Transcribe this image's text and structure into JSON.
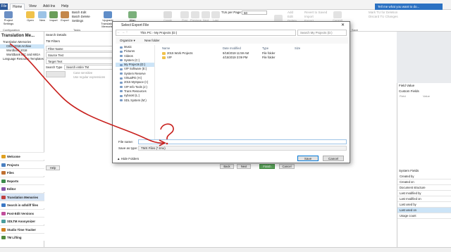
{
  "app": {
    "window_title": "SDL Trados Studio"
  },
  "menu": {
    "file": "File",
    "tabs": [
      "Home",
      "View",
      "Add-Ins",
      "Help"
    ],
    "tell_me": "Tell me what you want to do..."
  },
  "ribbon": {
    "buttons": [
      {
        "label": "Project Settings"
      },
      {
        "label": "Open"
      },
      {
        "label": "New"
      },
      {
        "label": "Import"
      },
      {
        "label": "Export"
      }
    ],
    "small": [
      "Batch Edit",
      "Batch Delete",
      "Settings"
    ],
    "upgrade": "Upgrade Translation Memories",
    "align": "Align Documents",
    "tus_label": "TUs per Page:",
    "tus_value": "50",
    "dim": [
      "Create Autosuggest Dictionary",
      "First Page",
      "Previous Page",
      "Next Page",
      "Last Page",
      "Perform Search",
      "Add",
      "Edit",
      "Delete",
      "Revert to Saved",
      "Import",
      "Export",
      "Commit Changes"
    ],
    "right": [
      "Mark TU for Deletion",
      "Discard TU Changes"
    ],
    "groups": [
      "Configuration",
      "Tasks",
      "Navigation",
      "Save"
    ]
  },
  "left": {
    "title": "Translation Me...",
    "tree": [
      "Translation Memories",
      "CIBC 2018 Archive",
      "Wordbank 2018",
      "Worldbank IPC and MIGA",
      "Language Resource Templates"
    ],
    "nav": [
      {
        "label": "Welcome",
        "color": "#e0a020"
      },
      {
        "label": "Projects",
        "color": "#4a7fc0"
      },
      {
        "label": "Files",
        "color": "#c07030"
      },
      {
        "label": "Reports",
        "color": "#3c8c4c"
      },
      {
        "label": "Editor",
        "color": "#8855aa"
      },
      {
        "label": "Translation Memories",
        "color": "#c04040"
      },
      {
        "label": "Search in sdlxliff files",
        "color": "#3b78c4"
      },
      {
        "label": "Post-Edit Versions",
        "color": "#c04e9c"
      },
      {
        "label": "SDLTM Anonymizer",
        "color": "#4a9e9e"
      },
      {
        "label": "Studio Time Tracker",
        "color": "#d08020"
      },
      {
        "label": "TM Lifting",
        "color": "#508a3c"
      }
    ]
  },
  "center": {
    "search_details": "Search Details",
    "tm_filters": "TM Filters",
    "filter_name": "Filter Name",
    "source_text": "Source Text",
    "target_text": "Target Text",
    "search_type_label": "Search Type",
    "search_type_value": "Search entire TM",
    "case_sensitive": "Case sensitive",
    "use_regex": "Use regular expressions"
  },
  "right": {
    "field_value": "Field Value",
    "custom_fields": "Custom Fields",
    "col_a": "Field",
    "col_b": "Value",
    "system_fields": "System Fields",
    "sys_rows": [
      "Created by",
      "Created on",
      "Document structure",
      "Last modified by",
      "Last modified on",
      "Last used by",
      "Last used on",
      "Usage count"
    ]
  },
  "dialog": {
    "title": "Select Export File",
    "path": [
      "This PC",
      "My Projects (D:)"
    ],
    "search_placeholder": "Search My Projects (D:)",
    "organize": "Organize ▾",
    "new_folder": "New folder",
    "nav_items": [
      "Music",
      "Pictures",
      "Videos",
      "System (C:)",
      "My Projects (D:)",
      "VIP Software (E:)",
      "System Reserve",
      "VirtualFE (H:)",
      "2015 MySpace (I:)",
      "VIP Info Tools (J:)",
      "Trans Resources",
      "nyboost (L:)",
      "SDL System (M:)"
    ],
    "nav_selected": "My Projects (D:)",
    "columns": [
      "Name",
      "Date modified",
      "Type",
      "Size"
    ],
    "files": [
      {
        "name": "2015 Work Projects",
        "date": "9/18/2019 11:59 AM",
        "type": "File folder"
      },
      {
        "name": "VIP",
        "date": "4/15/2019 3:09 PM",
        "type": "File folder"
      }
    ],
    "file_name_label": "File name:",
    "file_name_value": "",
    "save_as_label": "Save as type:",
    "save_as_value": "TMX Files (*.tmx)",
    "hide_folders": "Hide Folders",
    "save": "Save",
    "cancel": "Cancel"
  },
  "annotation": {
    "mark": "?",
    "color": "#c8201d"
  },
  "bg_buttons": [
    "Help",
    "Back",
    "Next",
    "Finish",
    "Cancel"
  ]
}
